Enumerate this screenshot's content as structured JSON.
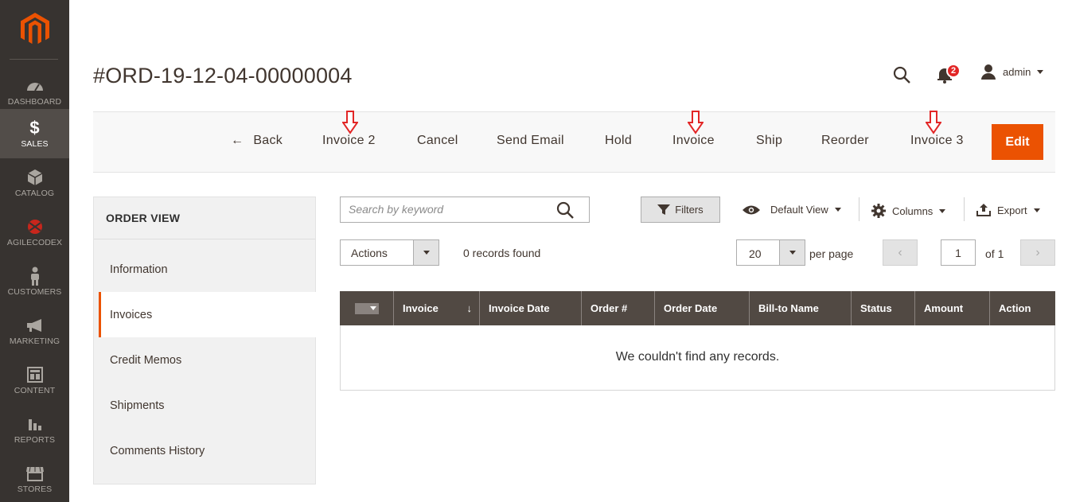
{
  "sidebar": {
    "logo": "magento-logo",
    "items": [
      {
        "label": "DASHBOARD",
        "icon": "dashboard-icon"
      },
      {
        "label": "SALES",
        "icon": "dollar-icon",
        "active": true
      },
      {
        "label": "CATALOG",
        "icon": "cube-icon"
      },
      {
        "label": "AGILECODEX",
        "icon": "agilecodex-icon"
      },
      {
        "label": "CUSTOMERS",
        "icon": "person-icon"
      },
      {
        "label": "MARKETING",
        "icon": "megaphone-icon"
      },
      {
        "label": "CONTENT",
        "icon": "layout-icon"
      },
      {
        "label": "REPORTS",
        "icon": "bar-chart-icon"
      },
      {
        "label": "STORES",
        "icon": "store-icon"
      }
    ]
  },
  "header": {
    "title": "#ORD-19-12-04-00000004",
    "notifications_count": "2",
    "user": "admin"
  },
  "action_bar": {
    "back": "Back",
    "invoice2": "Invoice 2",
    "cancel": "Cancel",
    "send_email": "Send Email",
    "hold": "Hold",
    "invoice": "Invoice",
    "ship": "Ship",
    "reorder": "Reorder",
    "invoice3": "Invoice 3",
    "edit": "Edit"
  },
  "order_view": {
    "title": "ORDER VIEW",
    "tabs": [
      {
        "label": "Information"
      },
      {
        "label": "Invoices",
        "active": true
      },
      {
        "label": "Credit Memos"
      },
      {
        "label": "Shipments"
      },
      {
        "label": "Comments History"
      }
    ]
  },
  "grid": {
    "search_placeholder": "Search by keyword",
    "filters": "Filters",
    "default_view": "Default View",
    "columns": "Columns",
    "export": "Export",
    "actions": "Actions",
    "records_found": "0 records found",
    "per_page_value": "20",
    "per_page_label": "per page",
    "page_value": "1",
    "page_of": "of 1",
    "headers": [
      "Invoice",
      "Invoice Date",
      "Order #",
      "Order Date",
      "Bill-to Name",
      "Status",
      "Amount",
      "Action"
    ],
    "empty_message": "We couldn't find any records."
  },
  "colors": {
    "sidebar_bg": "#373330",
    "accent": "#eb5202",
    "table_header": "#514943",
    "annotation_arrow": "#e22626"
  }
}
